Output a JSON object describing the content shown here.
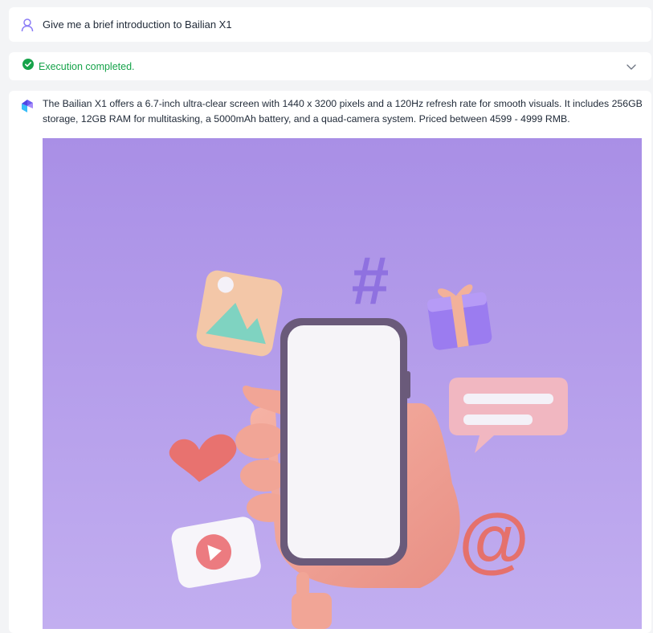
{
  "user_message": {
    "text": "Give me a brief introduction to Bailian X1"
  },
  "status": {
    "text": "Execution completed.",
    "color": "#16a34a"
  },
  "answer": {
    "text": "The Bailian X1 offers a 6.7-inch ultra-clear screen with 1440 x 3200 pixels and a 120Hz refresh rate for smooth visuals. It includes 256GB storage, 12GB RAM for multitasking, a 5000mAh battery, and a quad-camera system. Priced between 4599 - 4999 RMB."
  },
  "illustration": {
    "symbols": {
      "hash": "#",
      "at": "@"
    }
  },
  "colors": {
    "accent": "#7c6cf0",
    "background": "#f3f4f6",
    "illustration_bg": "#b9a4ec"
  },
  "icons": [
    "user-icon",
    "check-circle-icon",
    "chevron-down-icon",
    "bot-logo-icon"
  ]
}
